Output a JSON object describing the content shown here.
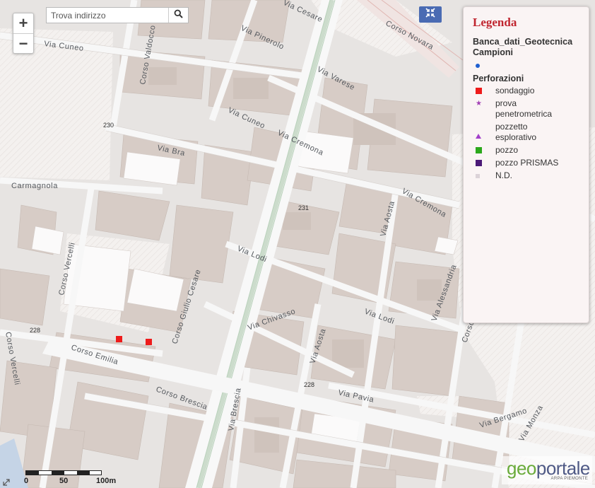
{
  "search": {
    "placeholder": "Trova indirizzo"
  },
  "zoom": {
    "in_label": "+",
    "out_label": "−"
  },
  "legend": {
    "title": "Legenda",
    "layer_name": "Banca_dati_Geotecnica Campioni",
    "layer_symbol_color": "#1f5fd0",
    "group_title": "Perforazioni",
    "items": [
      {
        "label": "sondaggio",
        "shape": "square",
        "color": "#ee1b1b"
      },
      {
        "label": "prova penetrometrica",
        "shape": "star",
        "color": "#a23fb5"
      },
      {
        "label": "pozzetto esplorativo",
        "shape": "triangle",
        "color": "#a23fc9"
      },
      {
        "label": "pozzo",
        "shape": "square",
        "color": "#2ca81c"
      },
      {
        "label": "pozzo PRISMAS",
        "shape": "square",
        "color": "#4b1a77"
      },
      {
        "label": "N.D.",
        "shape": "square",
        "color": "#dcd3d8"
      }
    ]
  },
  "map": {
    "streets": [
      "Via Cuneo",
      "Via Pinerolo",
      "Corso Novara",
      "Via Cesare",
      "Via Varese",
      "Via Cuneo",
      "Via Cremona",
      "Via Bra",
      "Carmagnola",
      "Via Cremona",
      "Via Aosta",
      "Via Lodi",
      "Corso Vercelli",
      "Corso Giulio Cesare",
      "Via Lodi",
      "Via Alessandria",
      "Via Chivasso",
      "Via Aosta",
      "Corso Emilia",
      "Corso Brescia",
      "Via Pavia",
      "Via Bergamo",
      "Via Monza",
      "Corso Vercelli",
      "Corso Valdocco",
      "Via Brescia",
      "Corso"
    ],
    "house_numbers": [
      "230",
      "231",
      "228",
      "228"
    ],
    "sondaggio_markers": 2
  },
  "scale": {
    "labels": [
      "0",
      "50",
      "100m"
    ]
  },
  "brand": {
    "part1": "geo",
    "part2": "portale",
    "sub": "ARPA PIEMONTE"
  }
}
